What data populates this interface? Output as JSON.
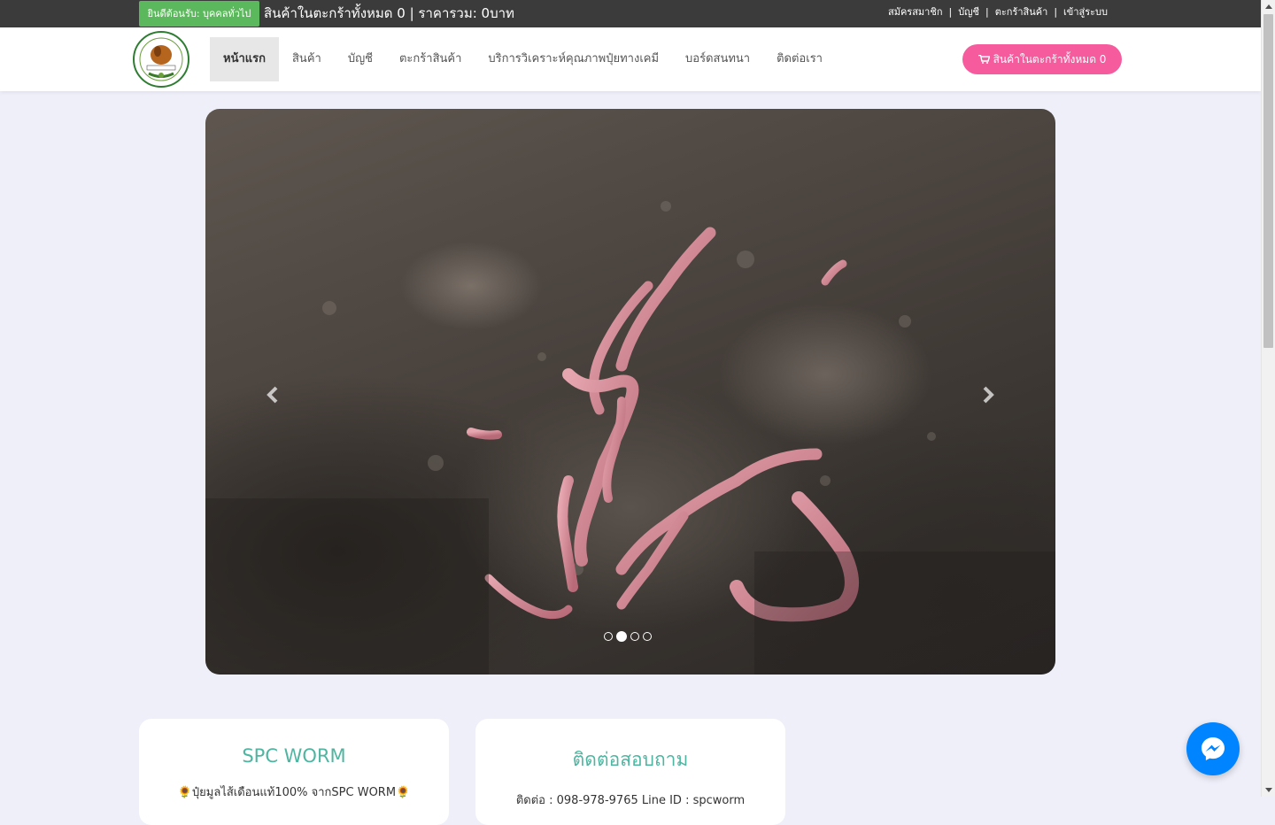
{
  "topbar": {
    "welcome_badge": "ยินดีต้อนรับ: บุคคลทั่วไป",
    "cart_summary": "สินค้าในตะกร้าทั้งหมด 0 | ราคารวม: 0บาท",
    "links": [
      "สมัครสมาชิก",
      "บัญชี",
      "ตะกร้าสินค้า",
      "เข้าสู่ระบบ"
    ],
    "separator": "|"
  },
  "nav": {
    "logo_icon": "spc-worm-logo",
    "items": [
      "หน้าแรก",
      "สินค้า",
      "บัญชี",
      "ตะกร้าสินค้า",
      "บริการวิเคราะห์คุณภาพปุ๋ยทางเคมี",
      "บอร์ดสนทนา",
      "ติดต่อเรา"
    ],
    "active_index": 0,
    "cart_button": "สินค้าในตะกร้าทั้งหมด 0",
    "cart_icon": "shopping-cart-icon"
  },
  "carousel": {
    "image": "earthworms-in-soil",
    "slide_count": 4,
    "active_slide": 1,
    "prev_icon": "chevron-left-icon",
    "next_icon": "chevron-right-icon"
  },
  "cards": [
    {
      "title": "SPC WORM",
      "text": "🌻ปุ๋ยมูลไส้เดือนแท้100% จากSPC WORM🌻"
    },
    {
      "title": "ติดต่อสอบถาม",
      "text": "ติดต่อ : 098-978-9765 Line ID : spcworm"
    }
  ],
  "messenger_icon": "messenger-icon",
  "colors": {
    "topbar": "#3b3b3b",
    "welcome": "#5cb85c",
    "cart_button": "#f55b9d",
    "card_title": "#4fb5a0",
    "page_bg": "#efeffa",
    "messenger": "#0084ff"
  }
}
